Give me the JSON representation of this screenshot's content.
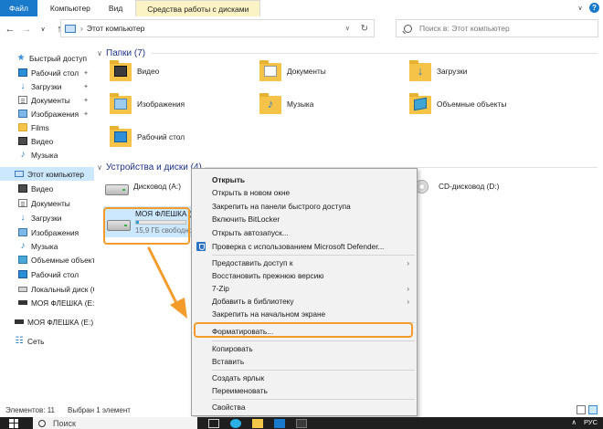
{
  "ribbon": {
    "tabs": [
      "Файл",
      "Компьютер",
      "Вид"
    ],
    "context_tab": "Средства работы с дисками"
  },
  "address": {
    "path": "Этот компьютер",
    "search_placeholder": "Поиск в: Этот компьютер"
  },
  "sidebar": {
    "items": [
      {
        "label": "Быстрый доступ",
        "icon": "star-icon"
      },
      {
        "label": "Рабочий стол",
        "icon": "desktop-icon",
        "pinned": true
      },
      {
        "label": "Загрузки",
        "icon": "download-icon",
        "pinned": true
      },
      {
        "label": "Документы",
        "icon": "documents-icon",
        "pinned": true
      },
      {
        "label": "Изображения",
        "icon": "pictures-icon",
        "pinned": true
      },
      {
        "label": "Films",
        "icon": "folder-icon"
      },
      {
        "label": "Видео",
        "icon": "video-icon"
      },
      {
        "label": "Музыка",
        "icon": "music-icon"
      },
      {
        "label": "Этот компьютер",
        "icon": "pc-icon",
        "selected": true
      },
      {
        "label": "Видео",
        "icon": "video-icon"
      },
      {
        "label": "Документы",
        "icon": "documents-icon"
      },
      {
        "label": "Загрузки",
        "icon": "download-icon"
      },
      {
        "label": "Изображения",
        "icon": "pictures-icon"
      },
      {
        "label": "Музыка",
        "icon": "music-icon"
      },
      {
        "label": "Объемные объекты",
        "icon": "3d-objects-icon"
      },
      {
        "label": "Рабочий стол",
        "icon": "desktop-icon"
      },
      {
        "label": "Локальный диск (C:)",
        "icon": "drive-icon"
      },
      {
        "label": "МОЯ ФЛЕШКА (E:)",
        "icon": "usb-drive-icon"
      },
      {
        "label": "МОЯ ФЛЕШКА (E:)",
        "icon": "usb-drive-icon"
      },
      {
        "label": "Сеть",
        "icon": "network-icon"
      }
    ]
  },
  "folders_group": {
    "title": "Папки (7)",
    "items": [
      {
        "label": "Видео",
        "icon": "videos-folder-icon"
      },
      {
        "label": "Документы",
        "icon": "documents-folder-icon"
      },
      {
        "label": "Загрузки",
        "icon": "downloads-folder-icon"
      },
      {
        "label": "Изображения",
        "icon": "pictures-folder-icon"
      },
      {
        "label": "Музыка",
        "icon": "music-folder-icon"
      },
      {
        "label": "Объемные объекты",
        "icon": "3d-objects-folder-icon"
      },
      {
        "label": "Рабочий стол",
        "icon": "desktop-folder-icon"
      }
    ]
  },
  "devices_group": {
    "title": "Устройства и диски (4)",
    "floppy": "Дисковод (A:)",
    "usb_name": "МОЯ ФЛЕШКА (",
    "usb_free": "15,9 ГБ свободно",
    "usb_used_fraction": 0.05,
    "cd": "CD-дисковод (D:)"
  },
  "context_menu": {
    "items": [
      {
        "label": "Открыть",
        "bold": true
      },
      {
        "label": "Открыть в новом окне"
      },
      {
        "label": "Закрепить на панели быстрого доступа"
      },
      {
        "label": "Включить BitLocker"
      },
      {
        "label": "Открыть автозапуск..."
      },
      {
        "label": "Проверка с использованием Microsoft Defender...",
        "icon": "defender-icon"
      },
      {
        "label": "Предоставить доступ к",
        "submenu": true
      },
      {
        "label": "Восстановить прежнюю версию"
      },
      {
        "label": "7-Zip",
        "submenu": true
      },
      {
        "label": "Добавить в библиотеку",
        "submenu": true
      },
      {
        "label": "Закрепить на начальном экране"
      },
      {
        "label": "Форматировать..."
      },
      {
        "label": "Копировать"
      },
      {
        "label": "Вставить"
      },
      {
        "label": "Создать ярлык"
      },
      {
        "label": "Переименовать"
      },
      {
        "label": "Свойства"
      }
    ]
  },
  "status": {
    "count": "Элементов: 11",
    "selected": "Выбран 1 элемент"
  },
  "taskbar": {
    "search": "Поиск",
    "lang": "РУС"
  },
  "colors": {
    "accent": "#1979ca",
    "highlight": "#f39c2b",
    "selection": "#cce8ff"
  }
}
